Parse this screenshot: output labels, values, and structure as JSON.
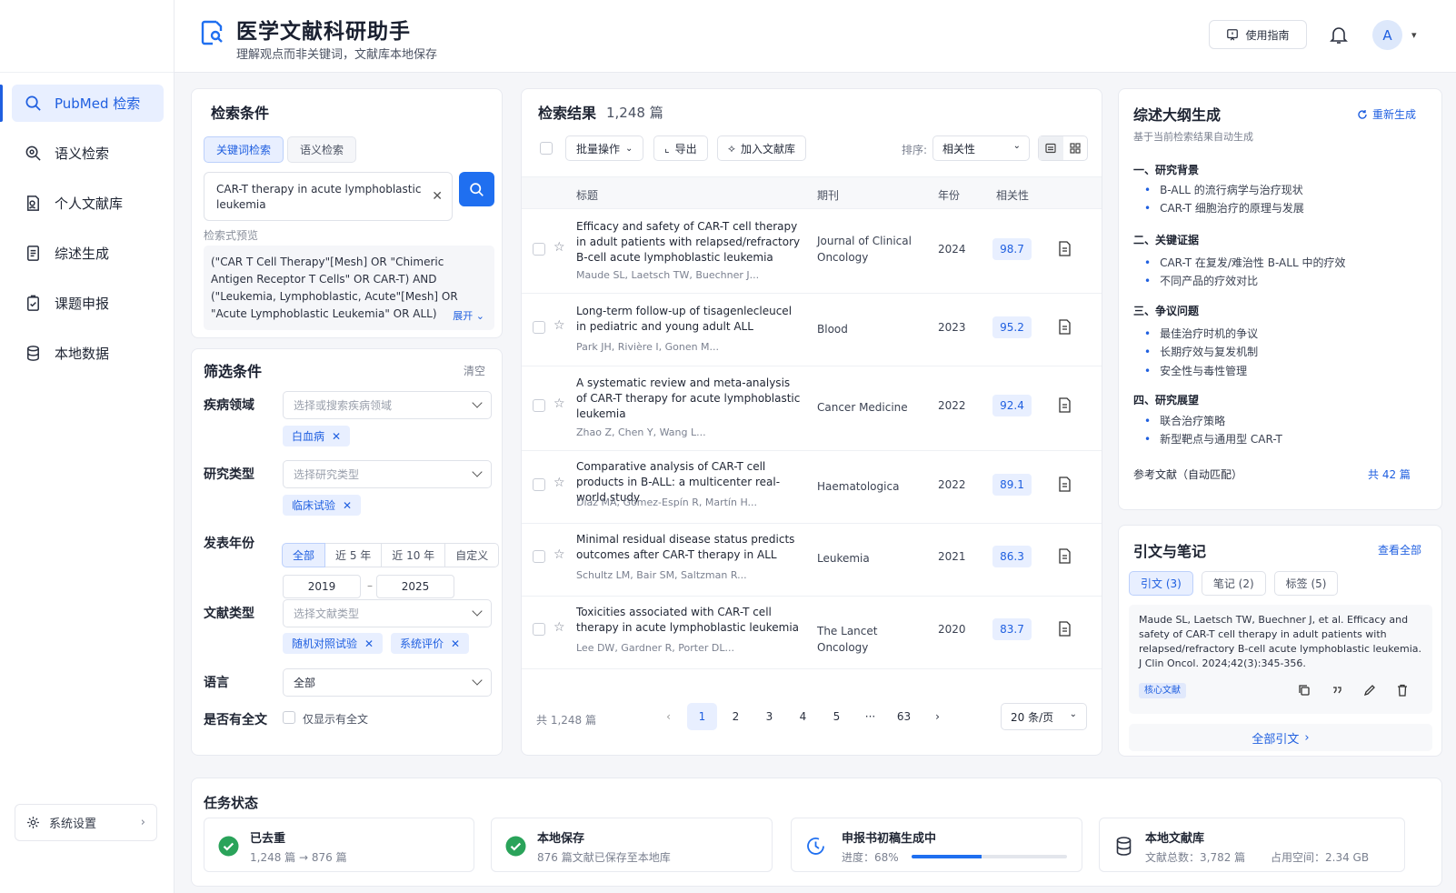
{
  "app": {
    "title": "医学文献科研助手",
    "subtitle": "理解观点而非关键词，文献库本地保存"
  },
  "header": {
    "guide_label": "使用指南",
    "avatar_initial": "A"
  },
  "sidebar": {
    "items": [
      {
        "label": "PubMed 检索",
        "icon": "search-icon"
      },
      {
        "label": "语义检索",
        "icon": "semantic-search-icon"
      },
      {
        "label": "个人文献库",
        "icon": "library-icon"
      },
      {
        "label": "综述生成",
        "icon": "document-icon"
      },
      {
        "label": "课题申报",
        "icon": "project-icon"
      },
      {
        "label": "本地数据",
        "icon": "database-icon"
      }
    ],
    "settings_label": "系统设置"
  },
  "search": {
    "title": "检索条件",
    "tabs": [
      "关键词检索",
      "语义检索"
    ],
    "query": "CAR-T therapy in acute lymphoblastic leukemia",
    "preview_label": "检索式预览",
    "preview": "(\"CAR T Cell Therapy\"[Mesh] OR \"Chimeric Antigen Receptor T Cells\" OR CAR-T) AND (\"Leukemia, Lymphoblastic, Acute\"[Mesh] OR \"Acute Lymphoblastic Leukemia\" OR ALL)",
    "expand_label": "展开"
  },
  "filters": {
    "title": "筛选条件",
    "clear_label": "清空",
    "disease": {
      "label": "疾病领域",
      "placeholder": "选择或搜索疾病领域",
      "tags": [
        "白血病"
      ]
    },
    "study_type": {
      "label": "研究类型",
      "placeholder": "选择研究类型",
      "tags": [
        "临床试验"
      ]
    },
    "year": {
      "label": "发表年份",
      "options": [
        "全部",
        "近 5 年",
        "近 10 年",
        "自定义"
      ],
      "from": "2019",
      "to": "2025"
    },
    "doc_type": {
      "label": "文献类型",
      "placeholder": "选择文献类型",
      "tags": [
        "随机对照试验",
        "系统评价"
      ]
    },
    "language": {
      "label": "语言",
      "value": "全部"
    },
    "fulltext": {
      "label": "是否有全文",
      "option": "仅显示有全文"
    }
  },
  "results": {
    "title": "检索结果",
    "count": "1,248 篇",
    "toolbar": {
      "batch": "批量操作",
      "export": "导出",
      "add": "加入文献库",
      "sort_label": "排序:",
      "sort_value": "相关性"
    },
    "columns": [
      "标题",
      "期刊",
      "年份",
      "相关性"
    ],
    "rows": [
      {
        "title": "Efficacy and safety of CAR-T cell therapy in adult patients with relapsed/refractory B-cell acute lymphoblastic leukemia",
        "authors": "Maude SL, Laetsch TW, Buechner J...",
        "journal": "Journal of Clinical Oncology",
        "year": "2024",
        "relevance": "98.7"
      },
      {
        "title": "Long-term follow-up of tisagenlecleucel in pediatric and young adult ALL",
        "authors": "Park JH, Rivière I, Gonen M...",
        "journal": "Blood",
        "year": "2023",
        "relevance": "95.2"
      },
      {
        "title": "A systematic review and meta-analysis of CAR-T therapy for acute lymphoblastic leukemia",
        "authors": "Zhao Z, Chen Y, Wang L...",
        "journal": "Cancer Medicine",
        "year": "2022",
        "relevance": "92.4"
      },
      {
        "title": "Comparative analysis of CAR-T cell products in B-ALL: a multicenter real-world study",
        "authors": "Díaz MA, Gómez-Espín R, Martín H...",
        "journal": "Haematologica",
        "year": "2022",
        "relevance": "89.1"
      },
      {
        "title": "Minimal residual disease status predicts outcomes after CAR-T therapy in ALL",
        "authors": "Schultz LM, Bair SM, Saltzman R...",
        "journal": "Leukemia",
        "year": "2021",
        "relevance": "86.3"
      },
      {
        "title": "Toxicities associated with CAR-T cell therapy in acute lymphoblastic leukemia",
        "authors": "Lee DW, Gardner R, Porter DL...",
        "journal": "The Lancet Oncology",
        "year": "2020",
        "relevance": "83.7"
      }
    ],
    "footer_count": "共 1,248 篇",
    "pages": [
      "1",
      "2",
      "3",
      "4",
      "5",
      "···",
      "63"
    ],
    "per_page": "20 条/页"
  },
  "outline": {
    "title": "综述大纲生成",
    "regen_label": "重新生成",
    "subtitle": "基于当前检索结果自动生成",
    "sections": [
      {
        "title": "一、研究背景",
        "items": [
          "B-ALL 的流行病学与治疗现状",
          "CAR-T 细胞治疗的原理与发展"
        ]
      },
      {
        "title": "二、关键证据",
        "items": [
          "CAR-T 在复发/难治性 B-ALL 中的疗效",
          "不同产品的疗效对比"
        ]
      },
      {
        "title": "三、争议问题",
        "items": [
          "最佳治疗时机的争议",
          "长期疗效与复发机制",
          "安全性与毒性管理"
        ]
      },
      {
        "title": "四、研究展望",
        "items": [
          "联合治疗策略",
          "新型靶点与通用型 CAR-T"
        ]
      }
    ],
    "ref_label": "参考文献（自动匹配）",
    "ref_count": "共 42 篇"
  },
  "citations": {
    "title": "引文与笔记",
    "view_all": "查看全部",
    "tabs": [
      "引文 (3)",
      "笔记 (2)",
      "标签 (5)"
    ],
    "citation_text": "Maude SL, Laetsch TW, Buechner J, et al. Efficacy and safety of CAR-T cell therapy in adult patients with relapsed/refractory B-cell acute lymphoblastic leukemia. J Clin Oncol. 2024;42(3):345-356.",
    "badge": "核心文献",
    "footer": "全部引文"
  },
  "tasks": {
    "title": "任务状态",
    "cards": [
      {
        "name": "已去重",
        "detail": "1,248 篇 → 876 篇"
      },
      {
        "name": "本地保存",
        "detail": "876 篇文献已保存至本地库"
      },
      {
        "name": "申报书初稿生成中",
        "detail": "进度：68%",
        "progress": 0.45
      },
      {
        "name": "本地文献库",
        "detail": "文献总数：3,782 篇",
        "extra": "占用空间：2.34 GB"
      }
    ]
  },
  "colors": {
    "accent": "#1f5fe0",
    "primary_button": "#1f6ff0",
    "success": "#2aa35a"
  }
}
